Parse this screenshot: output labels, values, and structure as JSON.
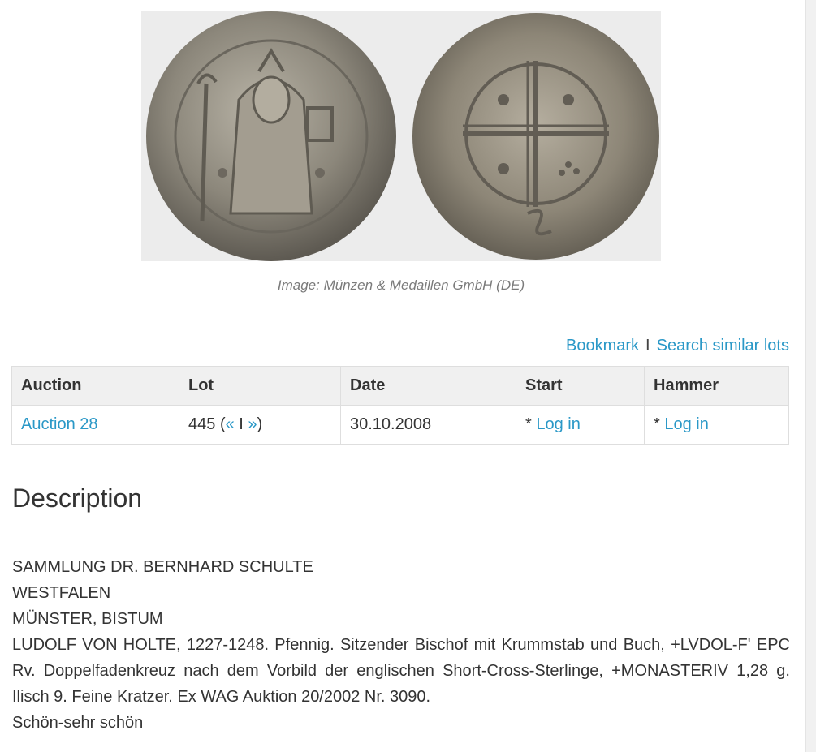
{
  "image": {
    "alt": "Coin obverse and reverse",
    "caption": "Image: Münzen & Medaillen GmbH (DE)"
  },
  "actions": {
    "bookmark": "Bookmark",
    "separator": "I",
    "search_similar": "Search similar lots"
  },
  "table": {
    "headers": [
      "Auction",
      "Lot",
      "Date",
      "Start",
      "Hammer"
    ],
    "row": {
      "auction": "Auction 28",
      "lot_number": "445",
      "lot_open": "(",
      "prev": "«",
      "lot_sep": "I",
      "next": "»",
      "lot_close": ")",
      "date": "30.10.2008",
      "start_prefix": "* ",
      "start_link": "Log in",
      "hammer_prefix": "* ",
      "hammer_link": "Log in"
    }
  },
  "description": {
    "title": "Description",
    "lines": [
      "SAMMLUNG DR. BERNHARD SCHULTE",
      "WESTFALEN",
      "MÜNSTER, BISTUM",
      "LUDOLF VON HOLTE, 1227-1248. Pfennig. Sitzender Bischof mit Krummstab und Buch, +LVDOL-F' EPC Rv. Doppelfadenkreuz nach dem Vorbild der englischen Short-Cross-Sterlinge, +MONASTERIV 1,28 g. Ilisch 9. Feine Kratzer. Ex WAG Auktion 20/2002 Nr. 3090.",
      "Schön-sehr schön"
    ]
  },
  "colors": {
    "link": "#2a98c7",
    "text": "#333333",
    "header_bg": "#f0f0f0",
    "coin_silver": "#9a958a"
  }
}
